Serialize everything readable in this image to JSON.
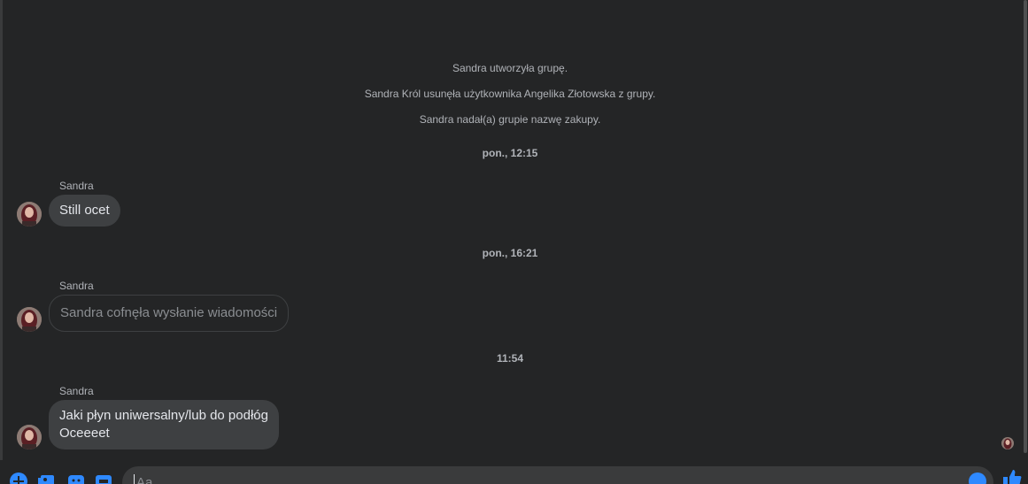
{
  "system_messages": [
    "Sandra utworzyła grupę.",
    "Sandra Król usunęła użytkownika Angelika Złotowska z grupy.",
    "Sandra nadał(a) grupie nazwę zakupy."
  ],
  "timestamps": [
    "pon., 12:15",
    "pon., 16:21",
    "11:54"
  ],
  "messages": [
    {
      "sender": "Sandra",
      "text": "Still ocet"
    },
    {
      "sender": "Sandra",
      "text": "Sandra cofnęła wysłanie wiadomości"
    },
    {
      "sender": "Sandra",
      "lines": [
        "Jaki płyn uniwersalny/lub do podłóg",
        "Oceeeet"
      ]
    }
  ],
  "composer": {
    "placeholder": "Aa",
    "tools": [
      "plus-icon",
      "photo-icon",
      "sticker-icon",
      "gif-icon"
    ],
    "emoji": "emoji-icon",
    "send": "thumbs-up-icon"
  },
  "colors": {
    "background": "#242526",
    "bubble": "#3e4042",
    "accent": "#2e89ff",
    "muted_text": "#b0b3b8"
  }
}
